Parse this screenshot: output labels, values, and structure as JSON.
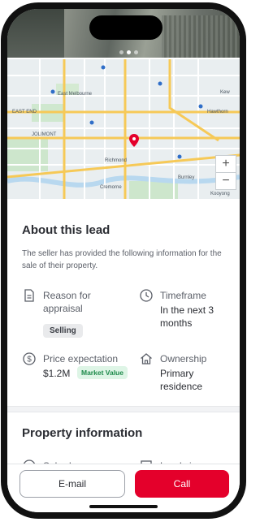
{
  "map": {
    "labels": [
      "East Melbourne",
      "EAST END",
      "JOLIMONT",
      "Richmond",
      "Cremorne",
      "Burnley",
      "Kew",
      "Hawthorn",
      "Kooyong"
    ],
    "zoom_in": "+",
    "zoom_out": "−"
  },
  "lead": {
    "title": "About this lead",
    "description": "The seller has provided the following information for the sale of their property.",
    "reason_label": "Reason for appraisal",
    "reason_value": "Selling",
    "timeframe_label": "Timeframe",
    "timeframe_value": "In the next 3 months",
    "price_label": "Price expectation",
    "price_value": "$1.2M",
    "price_badge": "Market Value",
    "ownership_label": "Ownership",
    "ownership_value": "Primary residence"
  },
  "property": {
    "title": "Property information",
    "suburb_label": "Suburb",
    "land_size_label": "Land size"
  },
  "footer": {
    "email_label": "E-mail",
    "call_label": "Call"
  },
  "colors": {
    "accent": "#e4002b",
    "badge_green_bg": "#def5e6",
    "badge_green_text": "#1e8a4b"
  }
}
